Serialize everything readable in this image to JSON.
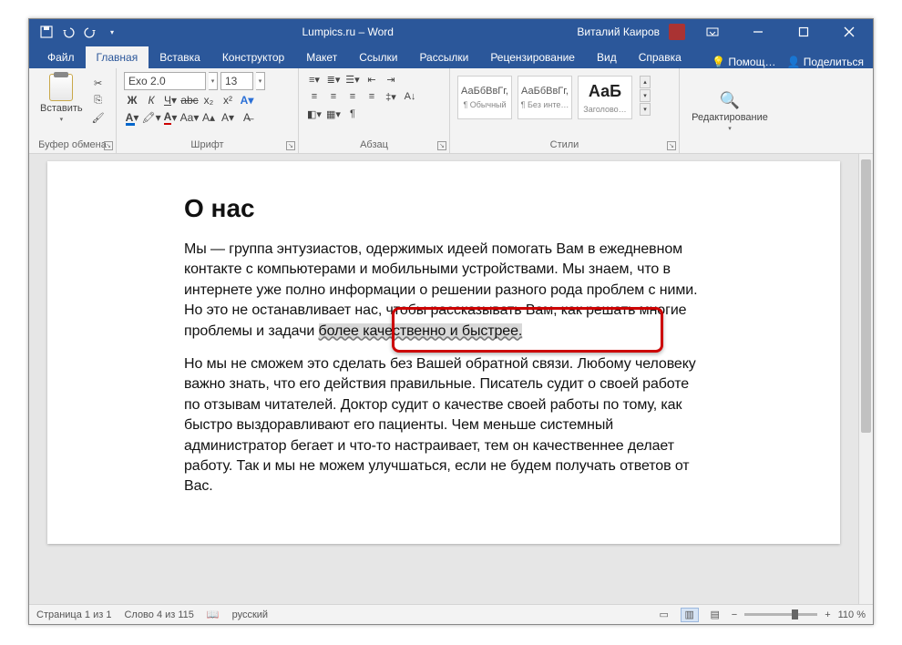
{
  "title": "Lumpics.ru  –  Word",
  "user": "Виталий Каиров",
  "tabs": {
    "file": "Файл",
    "home": "Главная",
    "insert": "Вставка",
    "design": "Конструктор",
    "layout": "Макет",
    "references": "Ссылки",
    "mailings": "Рассылки",
    "review": "Рецензирование",
    "view": "Вид",
    "help": "Справка",
    "tell": "Помощ…",
    "share": "Поделиться"
  },
  "ribbon": {
    "clipboard": {
      "paste": "Вставить",
      "label": "Буфер обмена"
    },
    "font": {
      "name": "Exo 2.0",
      "size": "13",
      "label": "Шрифт"
    },
    "paragraph": {
      "label": "Абзац"
    },
    "styles": {
      "label": "Стили",
      "s1": {
        "preview": "АаБбВвГг,",
        "name": "¶ Обычный"
      },
      "s2": {
        "preview": "АаБбВвГг,",
        "name": "¶ Без инте…"
      },
      "s3": {
        "preview": "АаБ",
        "name": "Заголово…"
      }
    },
    "editing": {
      "label": "Редактирование"
    }
  },
  "doc": {
    "heading": "О нас",
    "p1a": "Мы — группа энтузиастов, одержимых идеей помогать Вам в ежедневном контакте с компьютерами и мобильными устройствами. Мы знаем, что в интернете уже полно информации о решении разного рода проблем с ними. Но это не останавливает нас, чтобы рассказывать Вам, как решать многие проблемы и задачи ",
    "p1sel": "более качественно и быстрее.",
    "p2": "Но мы не сможем это сделать без Вашей обратной связи. Любому человеку важно знать, что его действия правильные. Писатель судит о своей работе по отзывам читателей. Доктор судит о качестве своей работы по тому, как быстро выздоравливают его пациенты. Чем меньше системный администратор бегает и что-то настраивает, тем он качественнее делает работу. Так и мы не можем улучшаться, если не будем получать ответов от Вас."
  },
  "status": {
    "page": "Страница 1 из 1",
    "words": "Слово 4 из 115",
    "lang": "русский",
    "zoom": "110 %"
  }
}
